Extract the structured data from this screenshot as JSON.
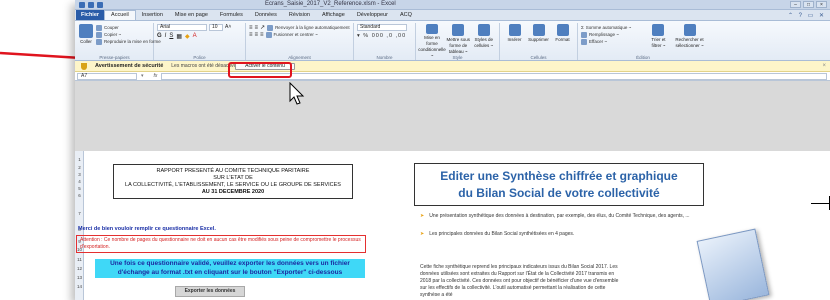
{
  "window": {
    "title": "Ecrans_Saisie_2017_V2_Reference.xlsm - Excel"
  },
  "tabs": [
    "Fichier",
    "Accueil",
    "Insertion",
    "Mise en page",
    "Formules",
    "Données",
    "Révision",
    "Affichage",
    "Développeur",
    "ACQ"
  ],
  "ribbon": {
    "clipboard": {
      "paste": "Coller",
      "cut": "Couper",
      "copy": "Copier ~",
      "format_painter": "Reproduire la mise en forme",
      "label": "Presse-papiers"
    },
    "font": {
      "name": "Arial",
      "size": "10",
      "label": "Police"
    },
    "alignment": {
      "wrap": "Renvoyer à la ligne automatiquement",
      "merge": "Fusionner et centrer ~",
      "label": "Alignement"
    },
    "number": {
      "format": "Standard",
      "label": "Nombre"
    },
    "styles": {
      "cond": "Mise en forme conditionnelle ~",
      "table": "Mettre sous forme de tableau ~",
      "cell": "Styles de cellules ~",
      "label": "Style"
    },
    "cells": {
      "insert": "Insérer",
      "delete": "Supprimer",
      "format": "Format",
      "label": "Cellules"
    },
    "editing": {
      "sum": "Somme automatique ~",
      "fill": "Remplissage ~",
      "clear": "Effacer ~",
      "sort": "Trier et filtrer ~",
      "find": "Rechercher et sélectionner ~",
      "label": "Édition"
    }
  },
  "security_bar": {
    "title": "Avertissement de sécurité",
    "text": "Les macros ont été désactivées.",
    "button": "Activer le contenu"
  },
  "formula_bar": {
    "cell": "A7",
    "fx": "fx"
  },
  "columns": [
    "A",
    "B",
    "C",
    "D",
    "E",
    "F",
    "G",
    "H",
    "I",
    "J",
    "K",
    "L",
    "M",
    "N",
    "O",
    "P",
    "Q",
    "R",
    "S"
  ],
  "rows": [
    "1",
    "2",
    "3",
    "4",
    "5",
    "6",
    "7",
    "8",
    "9",
    "10",
    "11",
    "12",
    "13",
    "14"
  ],
  "sheet": {
    "report_lines": [
      "RAPPORT PRESENTÉ AU COMITE TECHNIQUE PARITAIRE",
      "SUR L'ETAT DE",
      "LA COLLECTIVITÉ, L'ETABLISSEMENT, LE SERVICE OU LE GROUPE DE SERVICES",
      "AU 31 DECEMBRE 2020"
    ],
    "filled_title": "Merci de bien vouloir remplir ce questionnaire Excel.",
    "warning": "Attention : Ce nombre de pages du questionnaire ne doit en aucun cas être modifiés sous peine de compromettre le processus d'exportation.",
    "cyan_text": "Une fois ce questionnaire validé, veuillez exporter les données vers un fichier d'échange au format .txt en cliquant sur le bouton \"Exporter\" ci-dessous",
    "export_button": "Exporter les données",
    "right_title_1": "Editer une Synthèse chiffrée et graphique",
    "right_title_2": "du Bilan Social de votre collectivité",
    "bullet_1": "Une présentation synthétique des données à destination, par exemple, des élus, du Comité Technique, des agents, ...",
    "bullet_2": "Les principales données du Bilan Social synthétisées en 4 pages.",
    "paragraph": "Cette fiche synthétique reprend les principaux indicateurs issus du Bilan Social 2017. Les données utilisées sont extraites du Rapport sur l'État de la Collectivité 2017 transmis en 2018 par la collectivité. Ces données ont pour objectif de bénéficier d'une vue d'ensemble sur les effectifs de la collectivité. L'outil automatisé permettant la réalisation de cette synthèse a été"
  },
  "colors": {
    "highlight": "#e0141e",
    "cyan": "#3fd8f7",
    "title_blue": "#2c63a8",
    "warning_red": "#d42020"
  }
}
